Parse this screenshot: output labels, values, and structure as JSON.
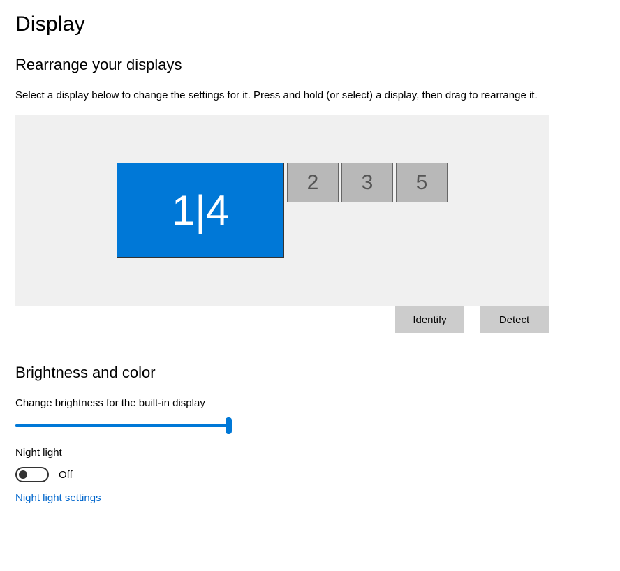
{
  "page": {
    "title": "Display"
  },
  "rearrange": {
    "heading": "Rearrange your displays",
    "instruction": "Select a display below to change the settings for it. Press and hold (or select) a display, then drag to rearrange it.",
    "primary_label": "1|4",
    "others": [
      "2",
      "3",
      "5"
    ],
    "identify_label": "Identify",
    "detect_label": "Detect"
  },
  "brightness": {
    "heading": "Brightness and color",
    "slider_label": "Change brightness for the built-in display",
    "night_light_label": "Night light",
    "night_light_status": "Off",
    "night_light_settings_link": "Night light settings"
  }
}
